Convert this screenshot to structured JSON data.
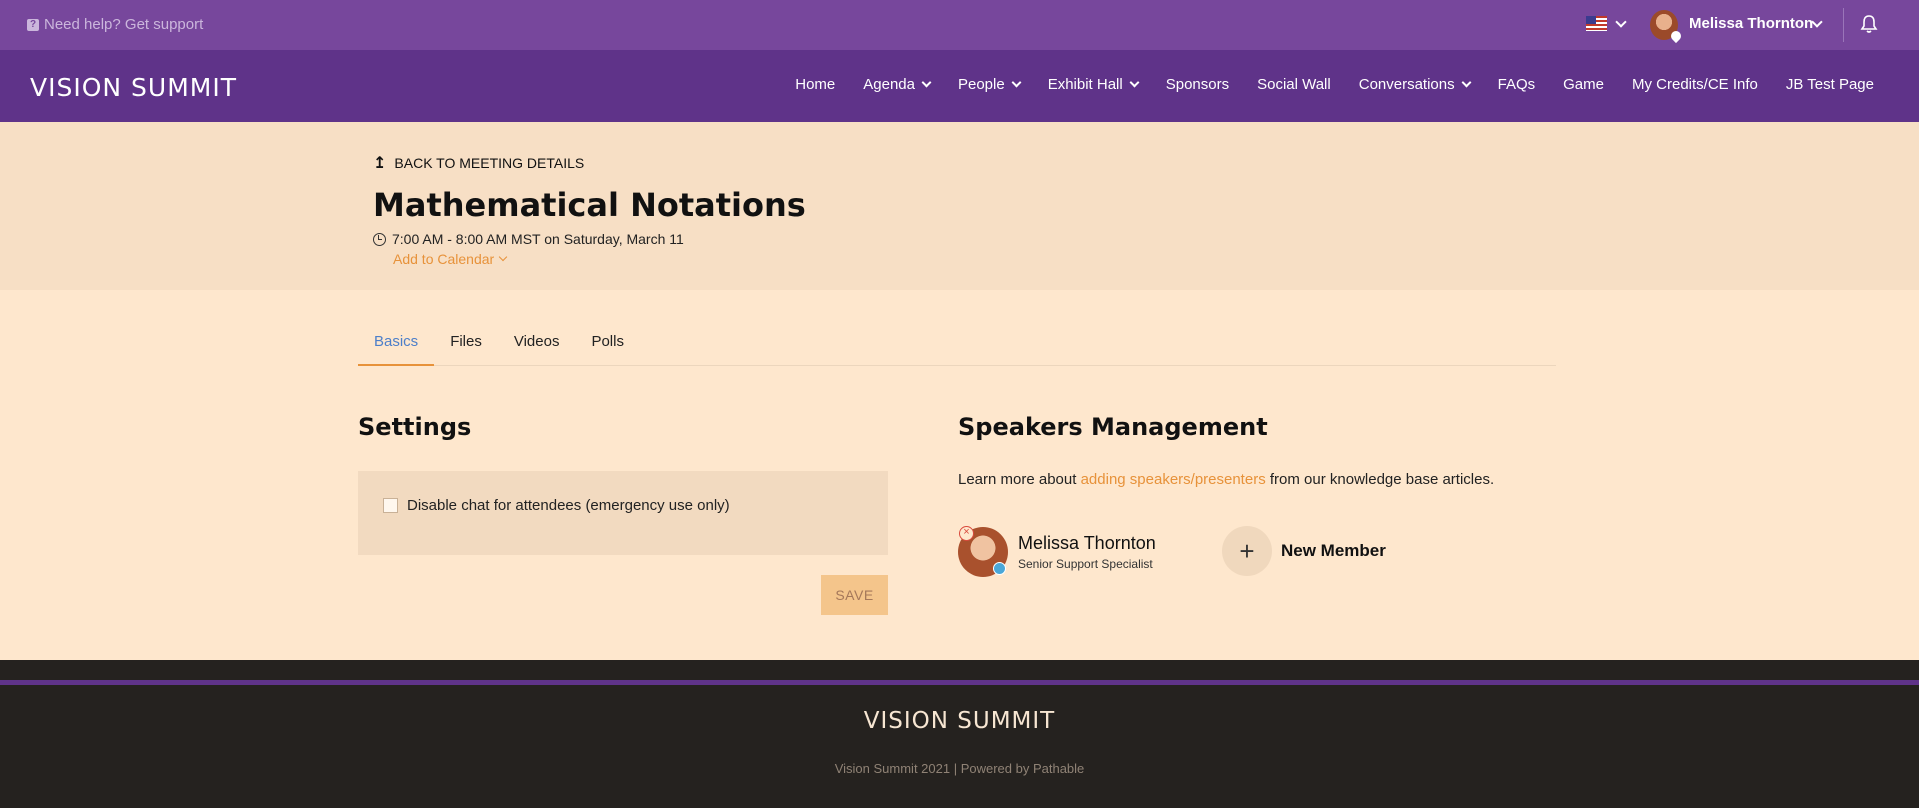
{
  "topbar": {
    "help_text": "Need help? Get support",
    "user_name": "Melissa Thornton"
  },
  "navbar": {
    "logo": "VISION SUMMIT",
    "items": [
      {
        "label": "Home"
      },
      {
        "label": "Agenda"
      },
      {
        "label": "People"
      },
      {
        "label": "Exhibit Hall"
      },
      {
        "label": "Sponsors"
      },
      {
        "label": "Social Wall"
      },
      {
        "label": "Conversations"
      },
      {
        "label": "FAQs"
      },
      {
        "label": "Game"
      },
      {
        "label": "My Credits/CE Info"
      },
      {
        "label": "JB Test Page"
      }
    ]
  },
  "header": {
    "back_label": "BACK TO MEETING DETAILS",
    "title": "Mathematical Notations",
    "time": "7:00 AM - 8:00 AM MST on Saturday, March 11",
    "add_to_calendar": "Add to Calendar"
  },
  "tabs": [
    {
      "label": "Basics"
    },
    {
      "label": "Files"
    },
    {
      "label": "Videos"
    },
    {
      "label": "Polls"
    }
  ],
  "settings": {
    "title": "Settings",
    "disable_chat_label": "Disable chat for attendees (emergency use only)",
    "save_label": "SAVE"
  },
  "speakers": {
    "title": "Speakers Management",
    "desc_before": "Learn more about ",
    "desc_link": "adding speakers/presenters",
    "desc_after": " from our knowledge base articles.",
    "member": {
      "name": "Melissa Thornton",
      "role": "Senior Support Specialist"
    },
    "new_member_label": "New Member"
  },
  "footer": {
    "logo": "VISION SUMMIT",
    "text": "Vision Summit 2021 | Powered by Pathable"
  },
  "colors": {
    "topbar": "#77479c",
    "navbar": "#5f3389",
    "accent": "#e7923a",
    "active_tab": "#4d7fc9"
  }
}
